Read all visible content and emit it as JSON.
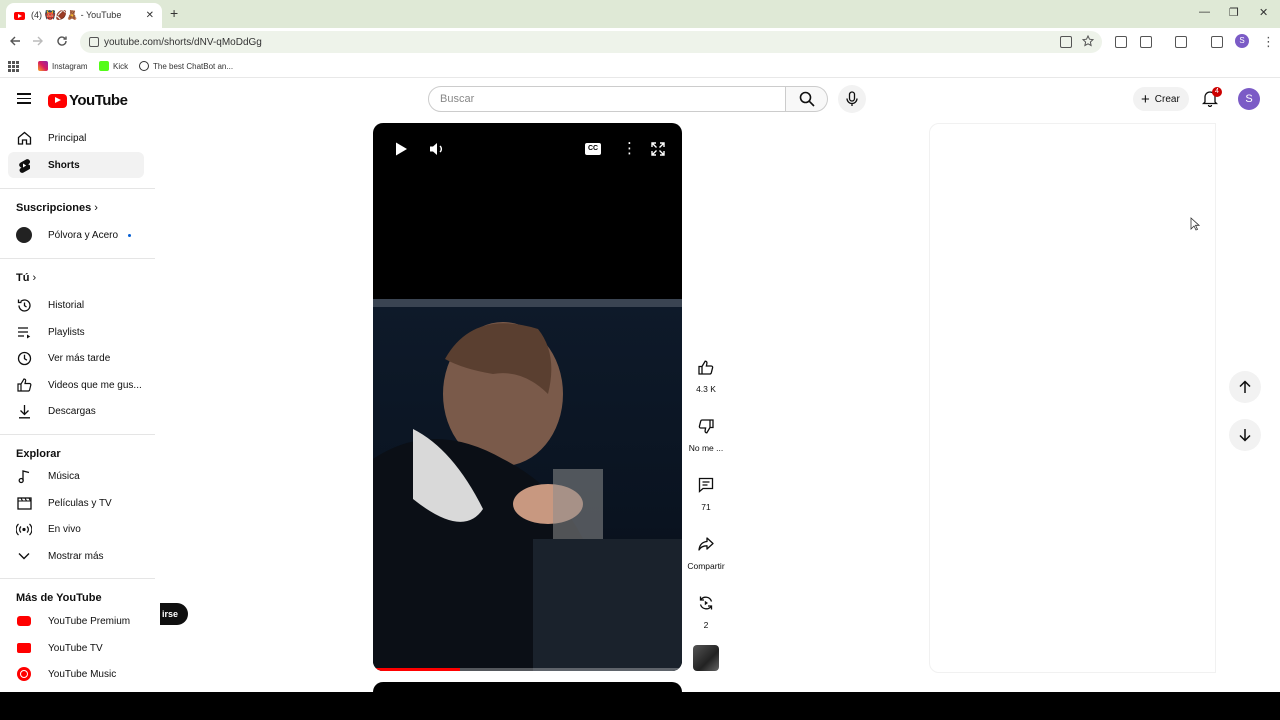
{
  "browser": {
    "tab_title": "(4) 👹🏈🧸 - YouTube",
    "tab_close": "✕",
    "new_tab": "+",
    "url": "youtube.com/shorts/dNV-qMoDdGg",
    "window_controls": {
      "minimize": "—",
      "restore": "❐",
      "close": "✕"
    },
    "profile_initial": "S",
    "bookmarks": [
      {
        "label": "Instagram"
      },
      {
        "label": "Kick"
      },
      {
        "label": "The best ChatBot an..."
      }
    ]
  },
  "masthead": {
    "logo_text": "YouTube",
    "search_placeholder": "Buscar",
    "create_label": "Crear",
    "notification_count": "4",
    "avatar_initial": "S"
  },
  "sidebar": {
    "main": [
      {
        "label": "Principal",
        "icon": "home-icon"
      },
      {
        "label": "Shorts",
        "icon": "shorts-icon",
        "active": true
      }
    ],
    "subscriptions_title": "Suscripciones",
    "subscriptions": [
      {
        "label": "Pólvora y Acero"
      }
    ],
    "you_title": "Tú",
    "you_items": [
      {
        "label": "Historial",
        "icon": "history-icon"
      },
      {
        "label": "Playlists",
        "icon": "playlists-icon"
      },
      {
        "label": "Ver más tarde",
        "icon": "watch-later-icon"
      },
      {
        "label": "Videos que me gus...",
        "icon": "liked-videos-icon"
      },
      {
        "label": "Descargas",
        "icon": "download-icon"
      }
    ],
    "explore_title": "Explorar",
    "explore_items": [
      {
        "label": "Música",
        "icon": "music-icon"
      },
      {
        "label": "Películas y TV",
        "icon": "movies-icon"
      },
      {
        "label": "En vivo",
        "icon": "live-icon"
      },
      {
        "label": "Mostrar más",
        "icon": "chevron-down-icon"
      }
    ],
    "more_title": "Más de YouTube",
    "more_items": [
      {
        "label": "YouTube Premium",
        "color": "#ff0000"
      },
      {
        "label": "YouTube TV",
        "color": "#ff0000"
      },
      {
        "label": "YouTube Music",
        "color": "#ff0000"
      }
    ],
    "pill_fragment": "irse"
  },
  "player": {
    "progress_fraction": 0.28,
    "progress_color": "#ff0000"
  },
  "actions": {
    "likes": "4.3 K",
    "dislike_label": "No me ...",
    "comments": "71",
    "share_label": "Compartir",
    "remix_count": "2"
  },
  "colors": {
    "accent": "#ff0000",
    "avatar": "#7b5bc6",
    "badge": "#cc0000"
  }
}
